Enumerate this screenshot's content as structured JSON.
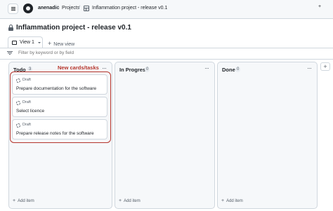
{
  "header": {
    "username": "anenadic",
    "projects_label": "Projects",
    "project_breadcrumb": "Inflammation project - release v0.1",
    "separator": "/",
    "user_chip": "+"
  },
  "project": {
    "title": "Inflammation project - release v0.1"
  },
  "views": {
    "active_view": "View 1",
    "new_view_label": "New view",
    "plus": "+"
  },
  "filter": {
    "placeholder": "Filter by keyword or by field"
  },
  "annotation": {
    "label": "New cards/tasks",
    "color": "#b5342b"
  },
  "columns": [
    {
      "title": "Todo",
      "count": "3",
      "more": "···",
      "add_item": "Add item",
      "cards": [
        {
          "status": "Draft",
          "title": "Prepare documentation for the software"
        },
        {
          "status": "Draft",
          "title": "Select licence"
        },
        {
          "status": "Draft",
          "title": "Prepare release notes for the software"
        }
      ]
    },
    {
      "title": "In Progress",
      "count": "0",
      "more": "···",
      "add_item": "Add item",
      "cards": []
    },
    {
      "title": "Done",
      "count": "0",
      "more": "···",
      "add_item": "Add item",
      "cards": []
    }
  ],
  "add_column": "+",
  "icons": {
    "menu": "hamburger-icon",
    "logo": "github-logo-icon",
    "table": "table-icon",
    "lock": "lock-icon",
    "board": "board-icon",
    "filter": "filter-icon",
    "draft": "draft-circle-icon"
  }
}
